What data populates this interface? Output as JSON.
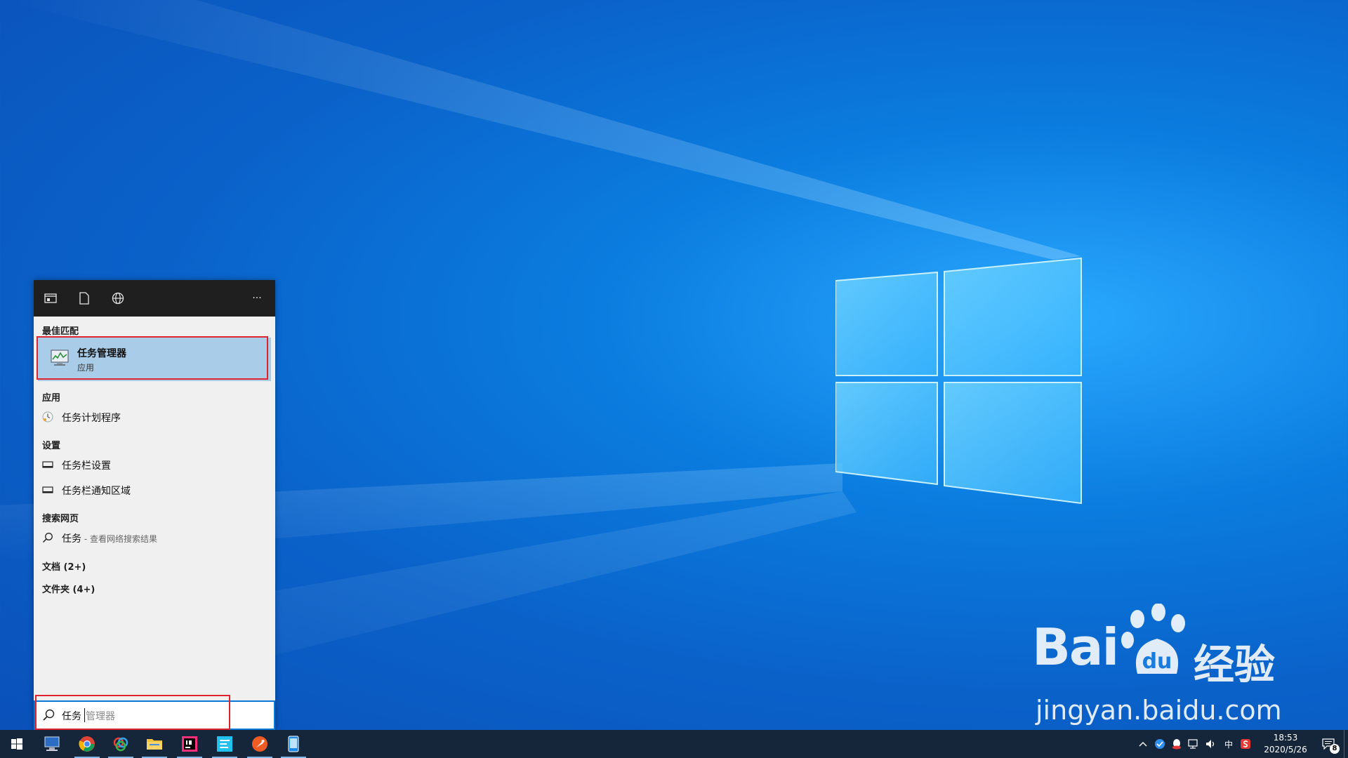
{
  "panel": {
    "toolbar_more": "···",
    "sections": {
      "best_match": "最佳匹配",
      "apps": "应用",
      "settings": "设置",
      "web": "搜索网页",
      "documents": "文档 (2+)",
      "folders": "文件夹 (4+)"
    },
    "best_match_item": {
      "title": "任务管理器",
      "subtitle": "应用"
    },
    "apps": [
      {
        "label": "任务计划程序"
      }
    ],
    "settings": [
      {
        "label": "任务栏设置"
      },
      {
        "label": "任务栏通知区域"
      }
    ],
    "web": {
      "query": "任务",
      "hint": " - 查看网络搜索结果"
    }
  },
  "search": {
    "typed": "任务",
    "suggestion": "管理器"
  },
  "taskbar": {
    "tray_ime": "中",
    "clock_time": "18:53",
    "clock_date": "2020/5/26",
    "notification_count": "8"
  },
  "watermark": {
    "brand": "Bai",
    "brand_suffix": "经验",
    "url": "jingyan.baidu.com",
    "paw_text": "du"
  },
  "colors": {
    "accent": "#0a78d7",
    "highlight": "#e0242f",
    "selection": "#a9cde9"
  }
}
